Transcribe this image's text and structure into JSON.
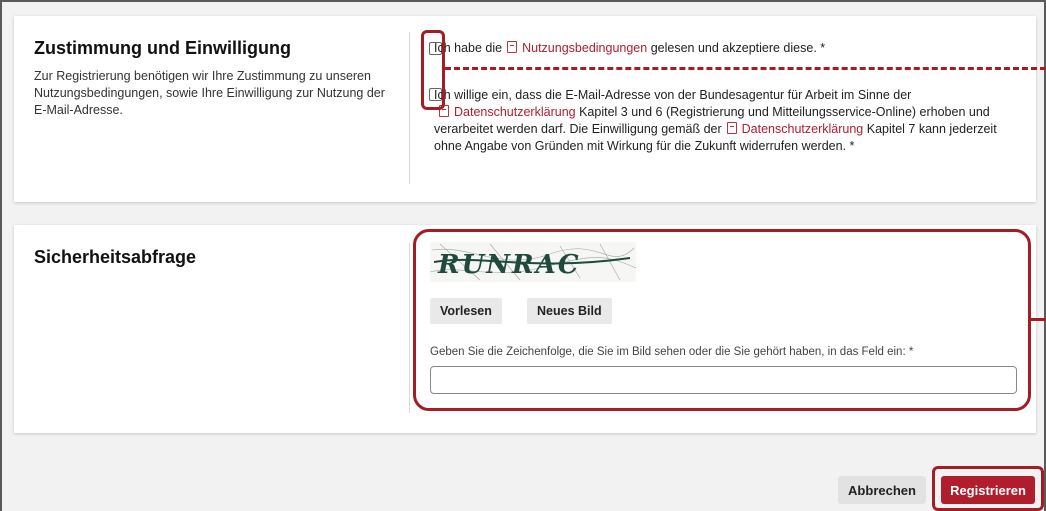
{
  "consent": {
    "title": "Zustimmung und Einwilligung",
    "description": "Zur Registrierung benötigen wir Ihre Zustimmung zu unseren Nutzungsbedingungen, sowie Ihre Einwilligung zur Nutzung der E-Mail-Adresse.",
    "terms": {
      "prefix": "Ich habe die",
      "link": "Nutzungsbedingungen",
      "suffix": "gelesen und akzeptiere diese. *"
    },
    "email": {
      "part1": "Ich willige ein, dass die E-Mail-Adresse von der Bundesagentur für Arbeit im Sinne der",
      "link1": "Datenschutzerklärung",
      "part2": "Kapitel 3 und 6 (Registrierung und Mitteilungsservice-Online) erhoben und verarbeitet werden darf. Die Einwilligung gemäß der",
      "link2": "Datenschutzerklärung",
      "part3": "Kapitel 7 kann jederzeit ohne Angabe von Gründen mit Wirkung für die Zukunft widerrufen werden. *"
    }
  },
  "security": {
    "title": "Sicherheitsabfrage",
    "captcha_text": "RUNRAC",
    "read_aloud_label": "Vorlesen",
    "new_image_label": "Neues Bild",
    "input_label": "Geben Sie die Zeichenfolge, die Sie im Bild sehen oder die Sie gehört haben, in das Feld ein: *",
    "input_value": ""
  },
  "actions": {
    "cancel_label": "Abbrechen",
    "submit_label": "Registrieren"
  },
  "colors": {
    "accent": "#b01e2d",
    "annotation": "#a41d24",
    "captcha_ink": "#1f4a3d"
  }
}
